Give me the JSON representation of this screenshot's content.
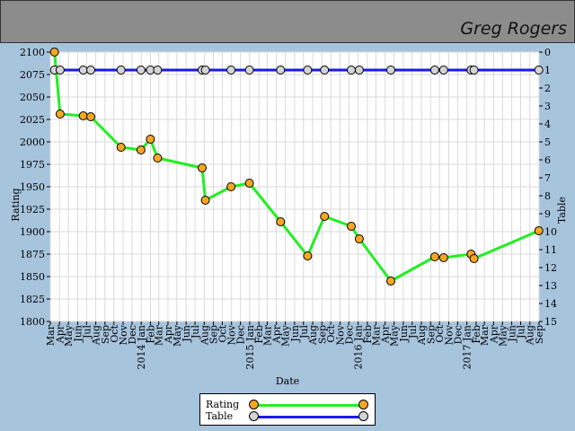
{
  "header": {
    "player_name": "Greg Rogers"
  },
  "chart_data": {
    "type": "line",
    "xlabel": "Date",
    "ylabel": "Rating",
    "y2label": "Table",
    "ylim": [
      1800,
      2100
    ],
    "y2lim": [
      0,
      15
    ],
    "y2_reversed": true,
    "yticks": [
      1800,
      1825,
      1850,
      1875,
      1900,
      1925,
      1950,
      1975,
      2000,
      2025,
      2050,
      2075,
      2100
    ],
    "y2ticks": [
      0,
      1,
      2,
      3,
      4,
      5,
      6,
      7,
      8,
      9,
      10,
      11,
      12,
      13,
      14,
      15
    ],
    "grid": true,
    "legend_position": "bottom",
    "month_ticks": [
      {
        "date": "2013-03",
        "label": "Mar"
      },
      {
        "date": "2013-04",
        "label": "Apr"
      },
      {
        "date": "2013-05",
        "label": "May"
      },
      {
        "date": "2013-06",
        "label": "Jun"
      },
      {
        "date": "2013-07",
        "label": "Jul"
      },
      {
        "date": "2013-08",
        "label": "Aug"
      },
      {
        "date": "2013-09",
        "label": "Sep"
      },
      {
        "date": "2013-10",
        "label": "Oct"
      },
      {
        "date": "2013-11",
        "label": "Nov"
      },
      {
        "date": "2013-12",
        "label": "Dec"
      },
      {
        "date": "2014-01",
        "label": "2014 Jan"
      },
      {
        "date": "2014-02",
        "label": "Feb"
      },
      {
        "date": "2014-03",
        "label": "Mar"
      },
      {
        "date": "2014-04",
        "label": "Apr"
      },
      {
        "date": "2014-05",
        "label": "May"
      },
      {
        "date": "2014-06",
        "label": "Jun"
      },
      {
        "date": "2014-07",
        "label": "Jul"
      },
      {
        "date": "2014-08",
        "label": "Aug"
      },
      {
        "date": "2014-09",
        "label": "Sep"
      },
      {
        "date": "2014-10",
        "label": "Oct"
      },
      {
        "date": "2014-11",
        "label": "Nov"
      },
      {
        "date": "2014-12",
        "label": "Dec"
      },
      {
        "date": "2015-01",
        "label": "2015 Jan"
      },
      {
        "date": "2015-02",
        "label": "Feb"
      },
      {
        "date": "2015-03",
        "label": "Mar"
      },
      {
        "date": "2015-04",
        "label": "Apr"
      },
      {
        "date": "2015-05",
        "label": "May"
      },
      {
        "date": "2015-06",
        "label": "Jun"
      },
      {
        "date": "2015-07",
        "label": "Jul"
      },
      {
        "date": "2015-08",
        "label": "Aug"
      },
      {
        "date": "2015-09",
        "label": "Sep"
      },
      {
        "date": "2015-10",
        "label": "Oct"
      },
      {
        "date": "2015-11",
        "label": "Nov"
      },
      {
        "date": "2015-12",
        "label": "Dec"
      },
      {
        "date": "2016-01",
        "label": "2016 Jan"
      },
      {
        "date": "2016-02",
        "label": "Feb"
      },
      {
        "date": "2016-03",
        "label": "Mar"
      },
      {
        "date": "2016-04",
        "label": "Apr"
      },
      {
        "date": "2016-05",
        "label": "May"
      },
      {
        "date": "2016-06",
        "label": "Jun"
      },
      {
        "date": "2016-07",
        "label": "Jul"
      },
      {
        "date": "2016-08",
        "label": "Aug"
      },
      {
        "date": "2016-09",
        "label": "Sep"
      },
      {
        "date": "2016-10",
        "label": "Oct"
      },
      {
        "date": "2016-11",
        "label": "Nov"
      },
      {
        "date": "2016-12",
        "label": "Dec"
      },
      {
        "date": "2017-01",
        "label": "2017 Jan"
      },
      {
        "date": "2017-02",
        "label": "Feb"
      },
      {
        "date": "2017-03",
        "label": "Mar"
      },
      {
        "date": "2017-04",
        "label": "Apr"
      },
      {
        "date": "2017-05",
        "label": "May"
      },
      {
        "date": "2017-06",
        "label": "Jun"
      },
      {
        "date": "2017-07",
        "label": "Jul"
      },
      {
        "date": "2017-08",
        "label": "Aug"
      },
      {
        "date": "2017-09",
        "label": "Sep"
      }
    ],
    "series": [
      {
        "name": "Rating",
        "axis": "left",
        "line_color": "#22ee22",
        "marker_color": "#f5a623",
        "points": [
          {
            "x": "2013-03-15",
            "y": 2100
          },
          {
            "x": "2013-04-03",
            "y": 2031
          },
          {
            "x": "2013-06-20",
            "y": 2029
          },
          {
            "x": "2013-07-15",
            "y": 2028
          },
          {
            "x": "2013-10-25",
            "y": 1994
          },
          {
            "x": "2013-12-31",
            "y": 1991
          },
          {
            "x": "2014-02-01",
            "y": 2003
          },
          {
            "x": "2014-02-25",
            "y": 1982
          },
          {
            "x": "2014-07-25",
            "y": 1971
          },
          {
            "x": "2014-08-05",
            "y": 1935
          },
          {
            "x": "2014-10-30",
            "y": 1950
          },
          {
            "x": "2014-12-31",
            "y": 1954
          },
          {
            "x": "2015-04-15",
            "y": 1911
          },
          {
            "x": "2015-07-15",
            "y": 1873
          },
          {
            "x": "2015-09-10",
            "y": 1917
          },
          {
            "x": "2015-12-09",
            "y": 1906
          },
          {
            "x": "2016-01-05",
            "y": 1892
          },
          {
            "x": "2016-04-20",
            "y": 1845
          },
          {
            "x": "2016-09-15",
            "y": 1872
          },
          {
            "x": "2016-10-15",
            "y": 1871
          },
          {
            "x": "2017-01-15",
            "y": 1875
          },
          {
            "x": "2017-01-25",
            "y": 1870
          },
          {
            "x": "2017-08-31",
            "y": 1901
          }
        ]
      },
      {
        "name": "Table",
        "axis": "right",
        "line_color": "#1a1aee",
        "marker_color": "#d4d4d4",
        "points": [
          {
            "x": "2013-03-15",
            "y": 1
          },
          {
            "x": "2013-04-03",
            "y": 1
          },
          {
            "x": "2013-06-20",
            "y": 1
          },
          {
            "x": "2013-07-15",
            "y": 1
          },
          {
            "x": "2013-10-25",
            "y": 1
          },
          {
            "x": "2013-12-31",
            "y": 1
          },
          {
            "x": "2014-02-01",
            "y": 1
          },
          {
            "x": "2014-02-25",
            "y": 1
          },
          {
            "x": "2014-07-25",
            "y": 1
          },
          {
            "x": "2014-08-05",
            "y": 1
          },
          {
            "x": "2014-10-30",
            "y": 1
          },
          {
            "x": "2014-12-31",
            "y": 1
          },
          {
            "x": "2015-04-15",
            "y": 1
          },
          {
            "x": "2015-07-15",
            "y": 1
          },
          {
            "x": "2015-09-10",
            "y": 1
          },
          {
            "x": "2015-12-09",
            "y": 1
          },
          {
            "x": "2016-01-05",
            "y": 1
          },
          {
            "x": "2016-04-20",
            "y": 1
          },
          {
            "x": "2016-09-15",
            "y": 1
          },
          {
            "x": "2016-10-15",
            "y": 1
          },
          {
            "x": "2017-01-15",
            "y": 1
          },
          {
            "x": "2017-01-25",
            "y": 1
          },
          {
            "x": "2017-08-31",
            "y": 1
          }
        ]
      }
    ]
  },
  "legend": {
    "rating_label": "Rating",
    "table_label": "Table"
  }
}
